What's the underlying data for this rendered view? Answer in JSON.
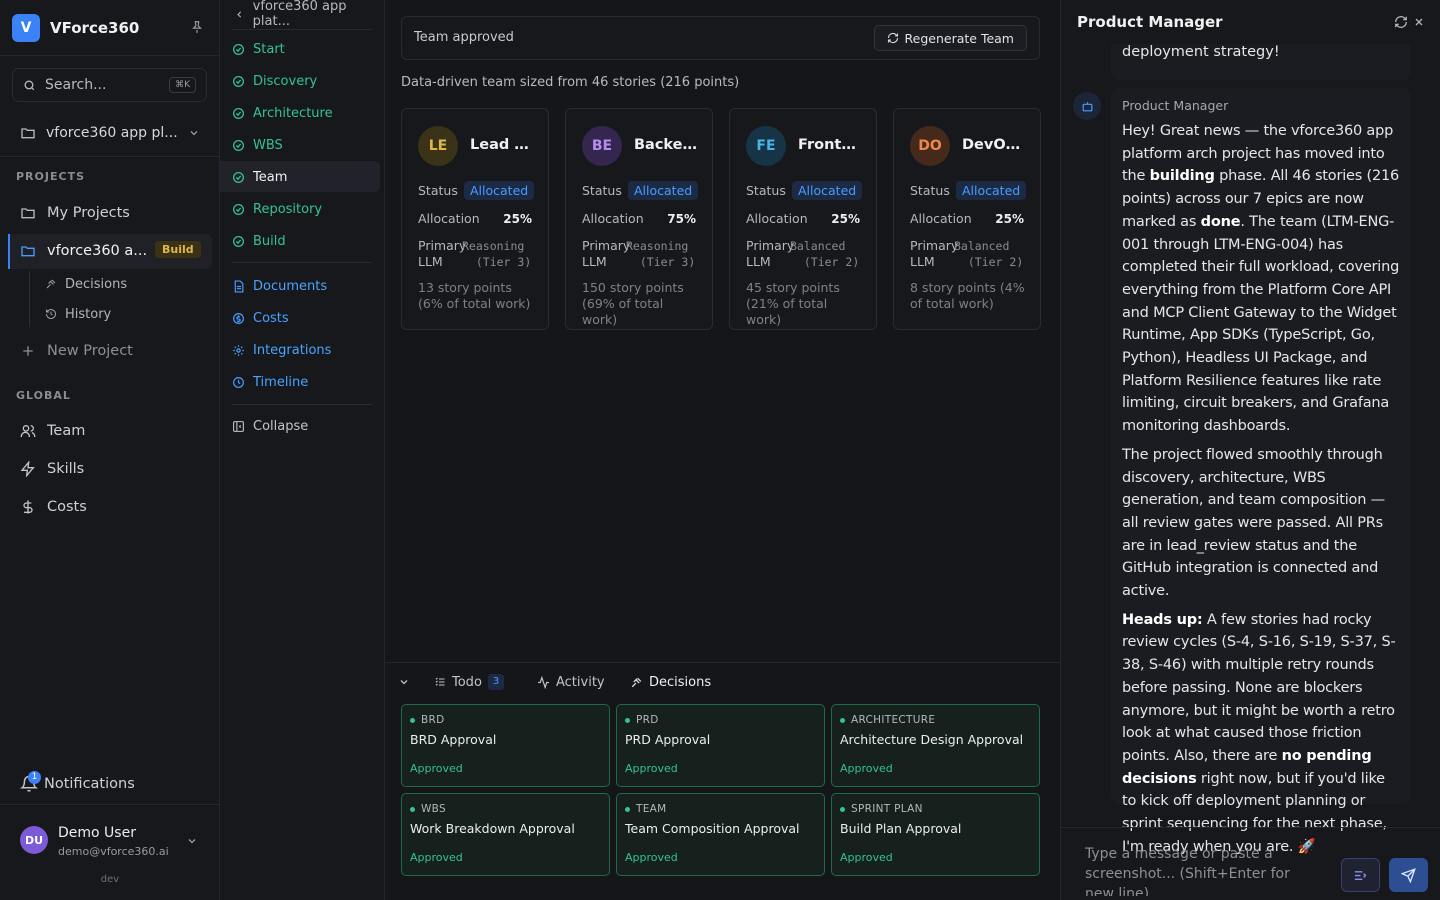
{
  "sidebar": {
    "brand": {
      "logo": "V",
      "name": "VForce360"
    },
    "search": {
      "placeholder": "Search...",
      "shortcut": "⌘K"
    },
    "project_selector": "vforce360 app pl...",
    "projects_label": "PROJECTS",
    "projects": [
      {
        "label": "My Projects",
        "icon": "folder-icon"
      },
      {
        "label": "vforce360 a...",
        "icon": "folder-icon",
        "badge": "Build",
        "active": true
      }
    ],
    "sub_items": [
      {
        "label": "Decisions",
        "icon": "gavel-icon"
      },
      {
        "label": "History",
        "icon": "history-icon"
      }
    ],
    "new_project": "New Project",
    "global_label": "GLOBAL",
    "global": [
      {
        "label": "Team",
        "icon": "users-icon"
      },
      {
        "label": "Skills",
        "icon": "zap-icon"
      },
      {
        "label": "Costs",
        "icon": "dollar-icon"
      }
    ],
    "notifications": {
      "label": "Notifications",
      "count": "1"
    },
    "user": {
      "initials": "DU",
      "name": "Demo User",
      "email": "demo@vforce360.ai"
    },
    "env": "dev"
  },
  "stage_nav": {
    "breadcrumb": "vforce360 app plat...",
    "stages": [
      {
        "label": "Start"
      },
      {
        "label": "Discovery"
      },
      {
        "label": "Architecture"
      },
      {
        "label": "WBS"
      },
      {
        "label": "Team",
        "active": true
      },
      {
        "label": "Repository"
      },
      {
        "label": "Build"
      }
    ],
    "links": [
      {
        "label": "Documents",
        "icon": "document-icon"
      },
      {
        "label": "Costs",
        "icon": "coin-icon"
      },
      {
        "label": "Integrations",
        "icon": "gear-icon"
      },
      {
        "label": "Timeline",
        "icon": "clock-icon"
      }
    ],
    "collapse": "Collapse"
  },
  "main": {
    "status": "Team approved",
    "regenerate_label": "Regenerate Team",
    "summary": "Data-driven team sized from 46 stories (216 points)",
    "labels": {
      "status": "Status",
      "allocation": "Allocation",
      "primary_llm": "Primary LLM"
    },
    "team": [
      {
        "initials": "LE",
        "title": "Lead E...",
        "status": "Allocated",
        "allocation": "25%",
        "llm": "Reasoning",
        "tier": "(Tier 3)",
        "story_points": "13 story points (6% of total work)",
        "color": "#e0b64a",
        "bg": "#3a3318"
      },
      {
        "initials": "BE",
        "title": "Backen...",
        "status": "Allocated",
        "allocation": "75%",
        "llm": "Reasoning",
        "tier": "(Tier 3)",
        "story_points": "150 story points (69% of total work)",
        "color": "#b58cf0",
        "bg": "#34264e"
      },
      {
        "initials": "FE",
        "title": "Fronte...",
        "status": "Allocated",
        "allocation": "25%",
        "llm": "Balanced",
        "tier": "(Tier 2)",
        "story_points": "45 story points (21% of total work)",
        "color": "#4ab3e8",
        "bg": "#163446"
      },
      {
        "initials": "DO",
        "title": "DevOp...",
        "status": "Allocated",
        "allocation": "25%",
        "llm": "Balanced",
        "tier": "(Tier 2)",
        "story_points": "8 story points (4% of total work)",
        "color": "#f0874a",
        "bg": "#45291a"
      }
    ]
  },
  "bottom_panel": {
    "tabs": [
      {
        "label": "Todo",
        "count": "3",
        "icon": "list-icon"
      },
      {
        "label": "Activity",
        "icon": "activity-icon"
      },
      {
        "label": "Decisions",
        "icon": "gavel-icon",
        "active": true
      }
    ],
    "decisions": [
      {
        "category": "BRD",
        "title": "BRD Approval",
        "status": "Approved"
      },
      {
        "category": "PRD",
        "title": "PRD Approval",
        "status": "Approved"
      },
      {
        "category": "ARCHITECTURE",
        "title": "Architecture Design Approval",
        "status": "Approved"
      },
      {
        "category": "WBS",
        "title": "Work Breakdown Approval",
        "status": "Approved"
      },
      {
        "category": "TEAM",
        "title": "Team Composition Approval",
        "status": "Approved"
      },
      {
        "category": "SPRINT PLAN",
        "title": "Build Plan Approval",
        "status": "Approved"
      }
    ]
  },
  "chat": {
    "title": "Product Manager",
    "previous_tail": "deployment strategy!",
    "author": "Product Manager",
    "p1_parts": [
      "Hey! Great news — the vforce360 app platform arch project has moved into the ",
      "building",
      " phase. All 46 stories (216 points) across our 7 epics are now marked as ",
      "done",
      ". The team (LTM-ENG-001 through LTM-ENG-004) has completed their full workload, covering everything from the Platform Core API and MCP Client Gateway to the Widget Runtime, App SDKs (TypeScript, Go, Python), Headless UI Package, and Platform Resilience features like rate limiting, circuit breakers, and Grafana monitoring dashboards."
    ],
    "p2": "The project flowed smoothly through discovery, architecture, WBS generation, and team composition — all review gates were passed. All PRs are in lead_review status and the GitHub integration is connected and active.",
    "p3_parts": [
      "Heads up:",
      " A few stories had rocky review cycles (S-4, S-16, S-19, S-37, S-38, S-46) with multiple retry rounds before passing. None are blockers anymore, but it might be worth a retro look at what caused those friction points. Also, there are ",
      "no pending decisions",
      " right now, but if you'd like to kick off deployment planning or sprint sequencing for the next phase, I'm ready when you are. 🚀"
    ],
    "composer_placeholder": "Type a message or paste a screenshot... (Shift+Enter for new line)"
  }
}
